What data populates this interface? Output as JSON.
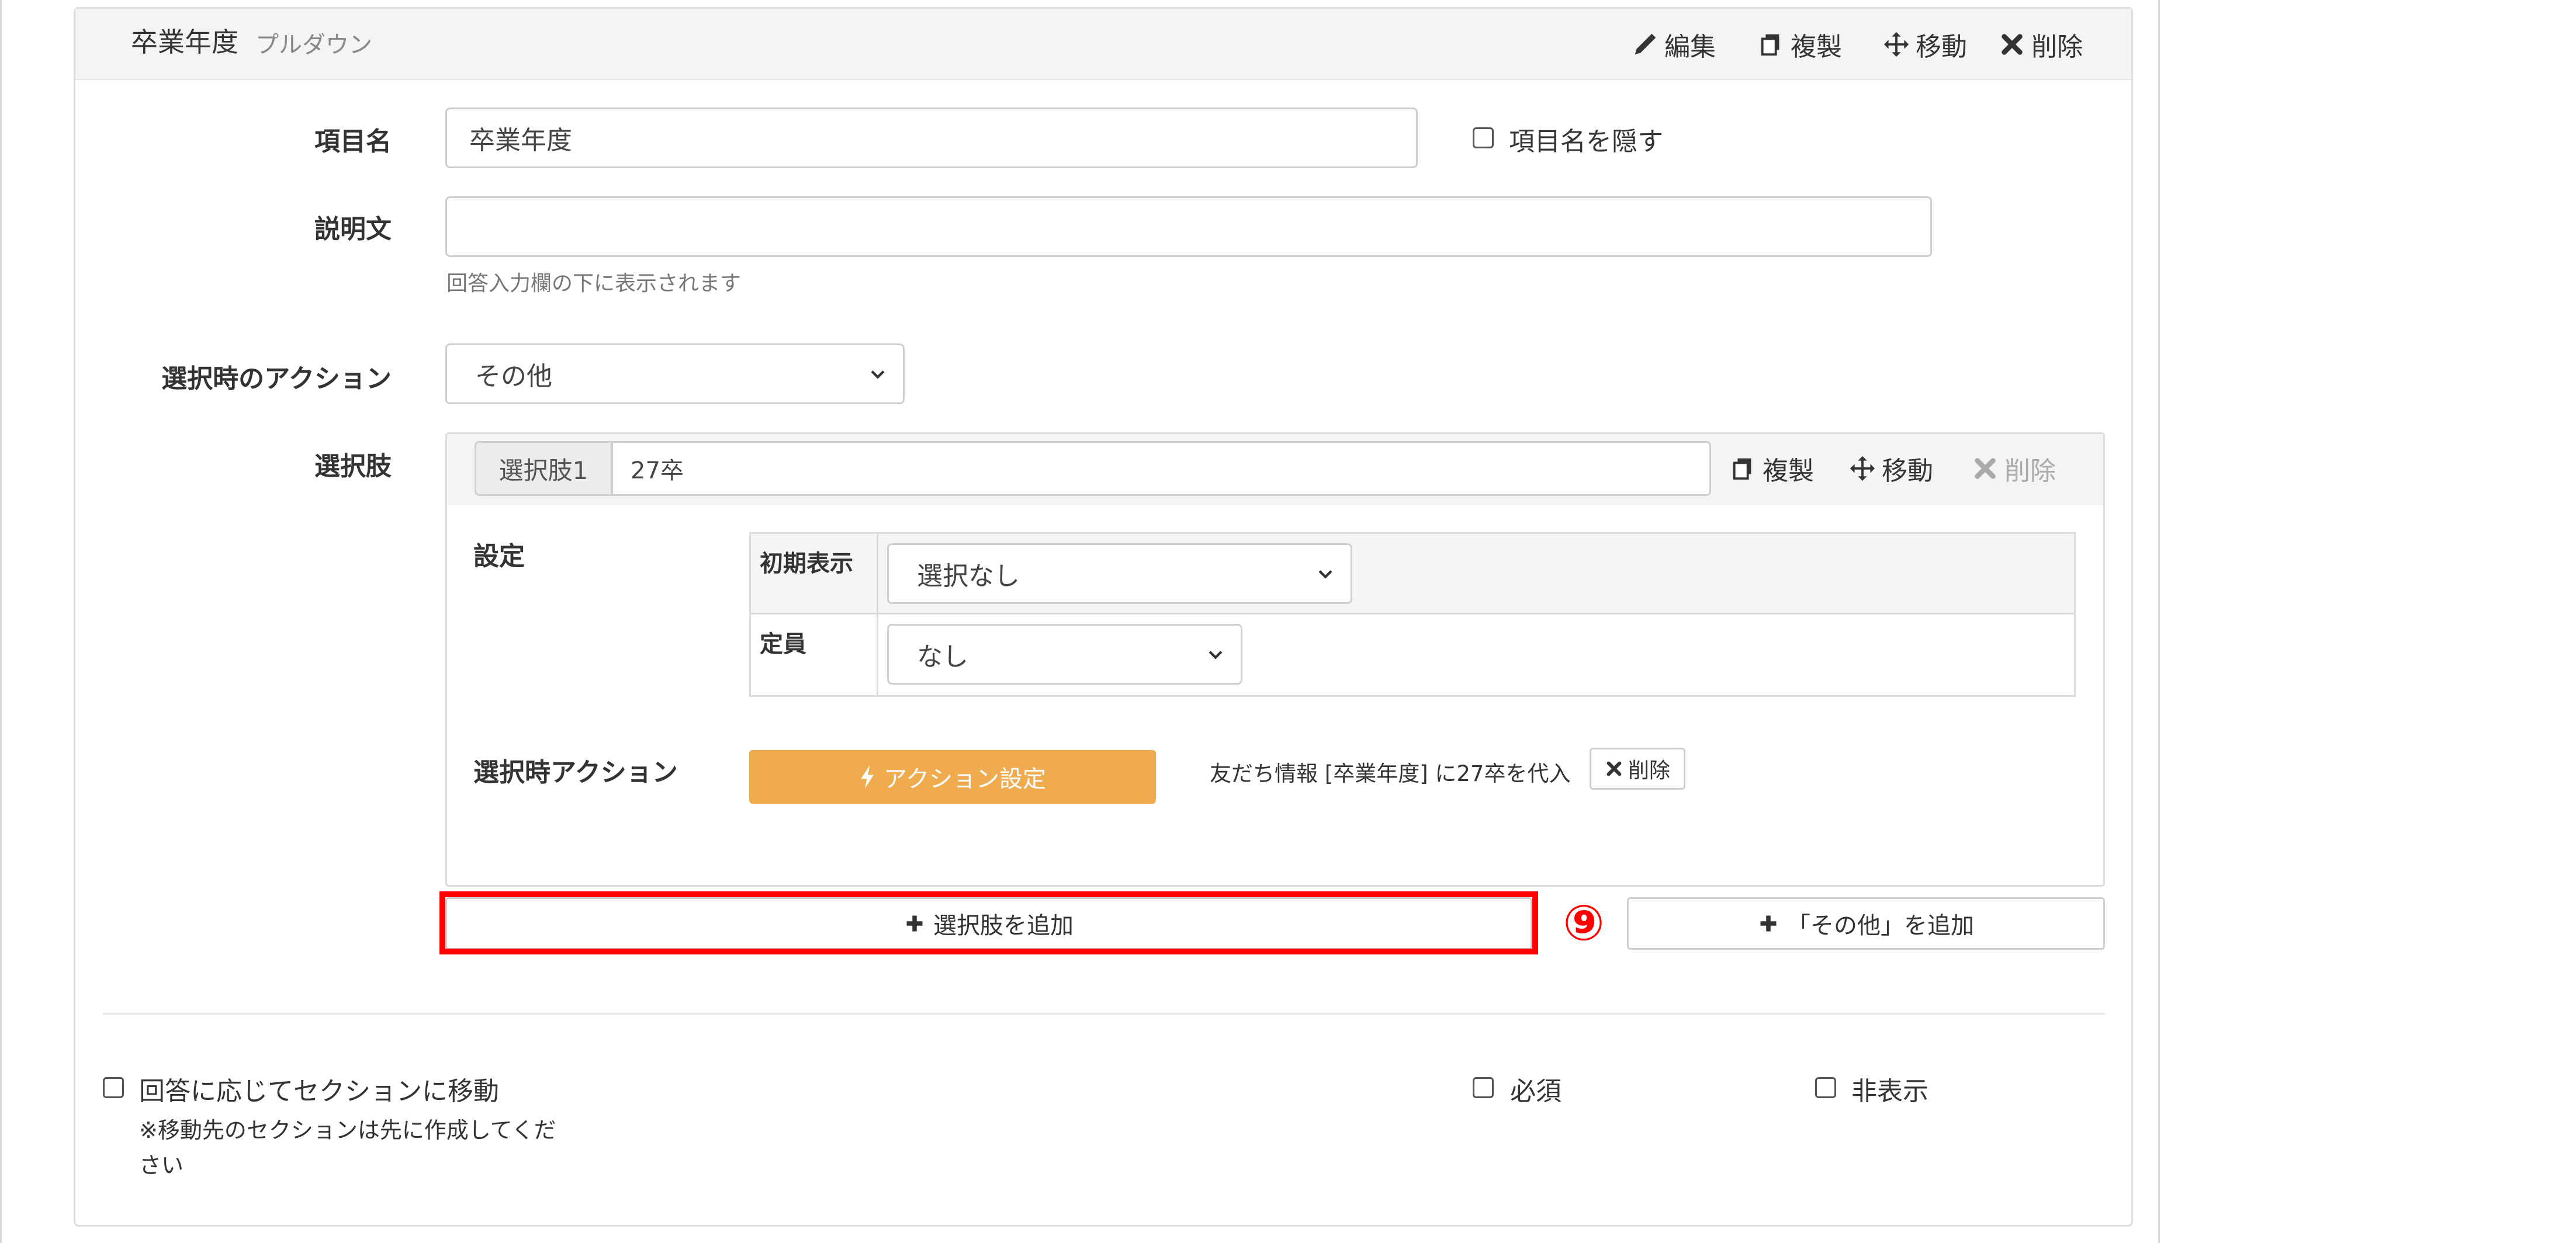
{
  "header": {
    "title": "卒業年度",
    "subtitle": "プルダウン",
    "edit_label": "編集",
    "duplicate_label": "複製",
    "move_label": "移動",
    "delete_label": "削除"
  },
  "form": {
    "item_name_label": "項目名",
    "item_name_value": "卒業年度",
    "hide_name_label": "項目名を隠す",
    "description_label": "説明文",
    "description_value": "",
    "description_help": "回答入力欄の下に表示されます",
    "select_action_label": "選択時のアクション",
    "select_action_value": "その他",
    "choices_label": "選択肢"
  },
  "choice": {
    "number_label": "選択肢1",
    "value": "27卒",
    "duplicate_label": "複製",
    "move_label": "移動",
    "delete_label": "削除",
    "settings_label": "設定",
    "initial_display_label": "初期表示",
    "initial_display_value": "選択なし",
    "capacity_label": "定員",
    "capacity_value": "なし",
    "action_label": "選択時アクション",
    "action_button_label": "アクション設定",
    "action_description": "友だち情報 [卒業年度] に27卒を代入",
    "action_delete_label": "削除"
  },
  "buttons": {
    "add_choice_label": "選択肢を追加",
    "add_other_label": "「その他」を追加"
  },
  "annotation": {
    "step_marker": "⑨",
    "highlight_color": "#ff0000"
  },
  "footer": {
    "section_jump_label": "回答に応じてセクションに移動",
    "section_jump_note_line1": "※移動先のセクションは先に作成してくだ",
    "section_jump_note_line2": "さい",
    "required_label": "必須",
    "hidden_label": "非表示"
  },
  "colors": {
    "action_button": "#efab4e",
    "header_bg": "#f4f4f4"
  }
}
